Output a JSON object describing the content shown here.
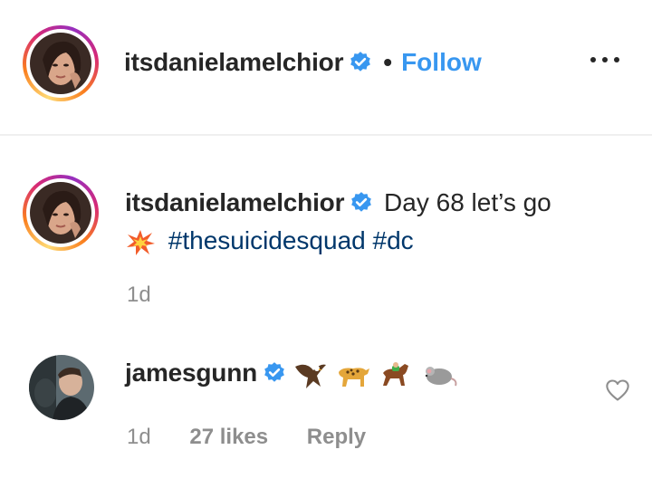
{
  "header": {
    "username": "itsdanielamelchior",
    "separator": "•",
    "follow_label": "Follow",
    "more_icon": "more-horizontal-icon"
  },
  "caption": {
    "username": "itsdanielamelchior",
    "text": "Day 68 let’s go",
    "emoji_icon": "collision-emoji-icon",
    "hashtags": [
      "#thesuicidesquad",
      "#dc"
    ],
    "age": "1d"
  },
  "comment": {
    "username": "jamesgunn",
    "emoji_icons": [
      "eagle-emoji-icon",
      "leopard-emoji-icon",
      "horse-racing-emoji-icon",
      "rat-emoji-icon"
    ],
    "age": "1d",
    "likes": "27 likes",
    "reply_label": "Reply",
    "heart_icon": "heart-outline-icon"
  },
  "colors": {
    "link_blue": "#3897f0",
    "hashtag": "#00376b",
    "verified": "#3897f0",
    "meta_gray": "#8e8e8e",
    "text": "#262626"
  }
}
